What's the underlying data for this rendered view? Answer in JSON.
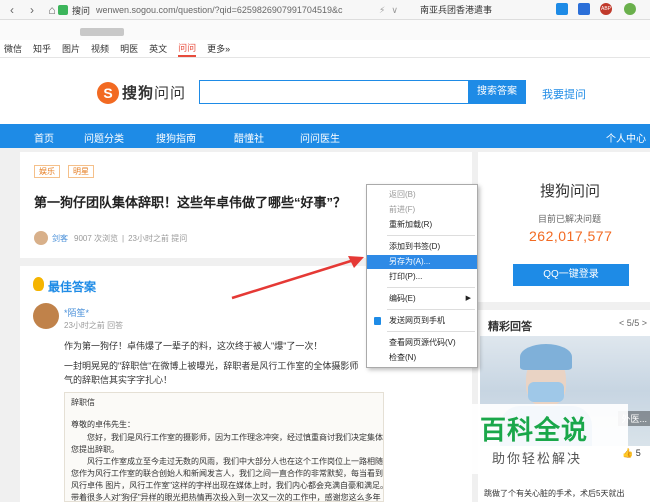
{
  "browser": {
    "address_label": "搜问",
    "url": "wenwen.sogou.com/question/?qid=6259826907991704519&c",
    "address_extras": [
      "⚡",
      "∨"
    ],
    "suggest": "南亚兵团香港遣事",
    "ext_badge": "ABP"
  },
  "tabs": [
    "微信",
    "知乎",
    "图片",
    "视频",
    "明医",
    "英文",
    "问问",
    "更多»"
  ],
  "tabs_active": "问问",
  "header": {
    "logo_s": "S",
    "logo_brand": "搜狗",
    "logo_suffix": "问问",
    "search_button": "搜索答案",
    "ask_link": "我要提问"
  },
  "nav": {
    "items": [
      "首页",
      "问题分类",
      "搜狗指南",
      "醋懂社",
      "问问医生"
    ],
    "user_center": "个人中心"
  },
  "question": {
    "tags": [
      "娱乐",
      "明星"
    ],
    "title": "第一狗仔团队集体辞职！这些年卓伟做了哪些“好事”？",
    "author": "剑客",
    "views": "9007 次浏览",
    "asked": "23小时之前 提问"
  },
  "context_menu": {
    "items": [
      {
        "label": "返回(B)",
        "disabled": true
      },
      {
        "label": "前进(F)",
        "disabled": true
      },
      {
        "label": "重新加载(R)",
        "disabled": false
      },
      {
        "label": "添加到书签(D)",
        "disabled": false
      },
      {
        "label": "另存为(A)...",
        "disabled": false,
        "highlight": true
      },
      {
        "label": "打印(P)...",
        "disabled": false
      },
      {
        "label": "编码(E)",
        "disabled": false,
        "submenu": true
      },
      {
        "label": "发送网页到手机",
        "disabled": false,
        "icon": true
      },
      {
        "label": "查看网页源代码(V)",
        "disabled": false
      },
      {
        "label": "检查(N)",
        "disabled": false
      }
    ]
  },
  "best_answer": {
    "heading": "最佳答案",
    "author": "*陌笙*",
    "time": "23小时之前 回答",
    "lines": [
      "作为第一狗仔！卓伟爆了一辈子的料，这次终于被人\"爆\"了一次！",
      "一封明晃晃的\"辞职信\"在微博上被曝光，辞职者是风行工作室的全体摄影师",
      "气的辞职信其实字字扎心！"
    ],
    "doc_lines": [
      "辞职信",
      "尊敬的卓伟先生：",
      "　　您好，我们是风行工作室的摄影师，因为工作理念冲突，经过慎重商讨我们决定集体向",
      "您提出辞职。",
      "　　风行工作室成立至今走过无数的风雨，我们中大部分人也在这个工作岗位上一路相随，",
      "您作为风行工作室的联合创始人和新闻发言人，我们之间一直合作的非常默契，每当看到\"撕",
      "风行卓伟 图片，风行工作室\"这样的字样出现在媒体上时，我们内心都会充满自豪和满足。",
      "带着很多人对\"狗仔\"异样的眼光把热情再次投入到一次又一次的工作中，感谢您这么多年"
    ]
  },
  "sidebar": {
    "title": "搜狗问问",
    "subtitle": "目前已解决问题",
    "count": "262,017,577",
    "qq_button": "QQ一键登录"
  },
  "jingcai": {
    "title": "精彩回答",
    "page": "< 5/5 >",
    "caption": "外医...",
    "bottom": "跳做了个有关心脏的手术，术后5天就出"
  },
  "watermark": {
    "title": "百科全说",
    "sub": "助你轻松解决",
    "like": "👍 5"
  }
}
